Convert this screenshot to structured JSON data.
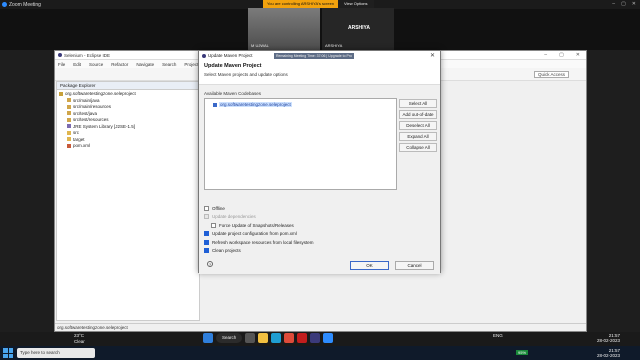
{
  "zoom": {
    "title": "Zoom Meeting",
    "banner_message": "You are controlling ARSHIYA's screen",
    "view_options": "View Options",
    "participants": [
      {
        "name": "M UJWAL"
      },
      {
        "name": "ARSHIYA"
      }
    ],
    "big_name": "ARSHIYA"
  },
  "eclipse": {
    "title": "Selenium - Eclipse IDE",
    "menu": [
      "File",
      "Edit",
      "Source",
      "Refactor",
      "Navigate",
      "Search",
      "Project"
    ],
    "quick_access": "Quick Access",
    "package_explorer": {
      "title": "Package Explorer",
      "items": [
        {
          "label": "org.softwaretestingzone.seleproject",
          "indent": 0
        },
        {
          "label": "src/main/java",
          "indent": 1
        },
        {
          "label": "src/main/resources",
          "indent": 1
        },
        {
          "label": "src/test/java",
          "indent": 1
        },
        {
          "label": "src/test/resources",
          "indent": 1
        },
        {
          "label": "JRE System Library [J2SE-1.5]",
          "indent": 1
        },
        {
          "label": "src",
          "indent": 1
        },
        {
          "label": "target",
          "indent": 1
        },
        {
          "label": "pom.xml",
          "indent": 1
        }
      ]
    },
    "status_bar": "org.softwaretestingzone.seleproject"
  },
  "dialog": {
    "window_title": "Update Maven Project",
    "tooltip": "Remaining Meeting Time: 37:06 | Upgrade to Pro",
    "header": "Update Maven Project",
    "subheader": "Select Maven projects and update options",
    "available_label": "Available Maven Codebases",
    "codebase_item": "org.softwaretestingzone.seleproject",
    "side_buttons": [
      "Select All",
      "Add out-of-date",
      "Deselect All",
      "Expand All",
      "Collapse All"
    ],
    "options": [
      {
        "label": "Offline",
        "checked": false,
        "disabled": false,
        "indent": false
      },
      {
        "label": "Update dependencies",
        "checked": false,
        "disabled": true,
        "indent": false
      },
      {
        "label": "Force Update of Snapshots/Releases",
        "checked": false,
        "disabled": false,
        "indent": true
      },
      {
        "label": "Update project configuration from pom.xml",
        "checked": true,
        "disabled": false,
        "indent": false
      },
      {
        "label": "Refresh workspace resources from local filesystem",
        "checked": true,
        "disabled": false,
        "indent": false
      },
      {
        "label": "Clean projects",
        "checked": true,
        "disabled": false,
        "indent": false
      }
    ],
    "ok": "OK",
    "cancel": "Cancel"
  },
  "taskbar": {
    "search_placeholder": "Type here to search",
    "weather_temp": "23°C",
    "weather_desc": "Clear",
    "search_pill": "Search",
    "lang": "ENG",
    "battery": "95%",
    "time_top": "21:57",
    "date_top": "28-02-2023",
    "time_bottom": "21:57",
    "date_bottom": "28-02-2023"
  }
}
